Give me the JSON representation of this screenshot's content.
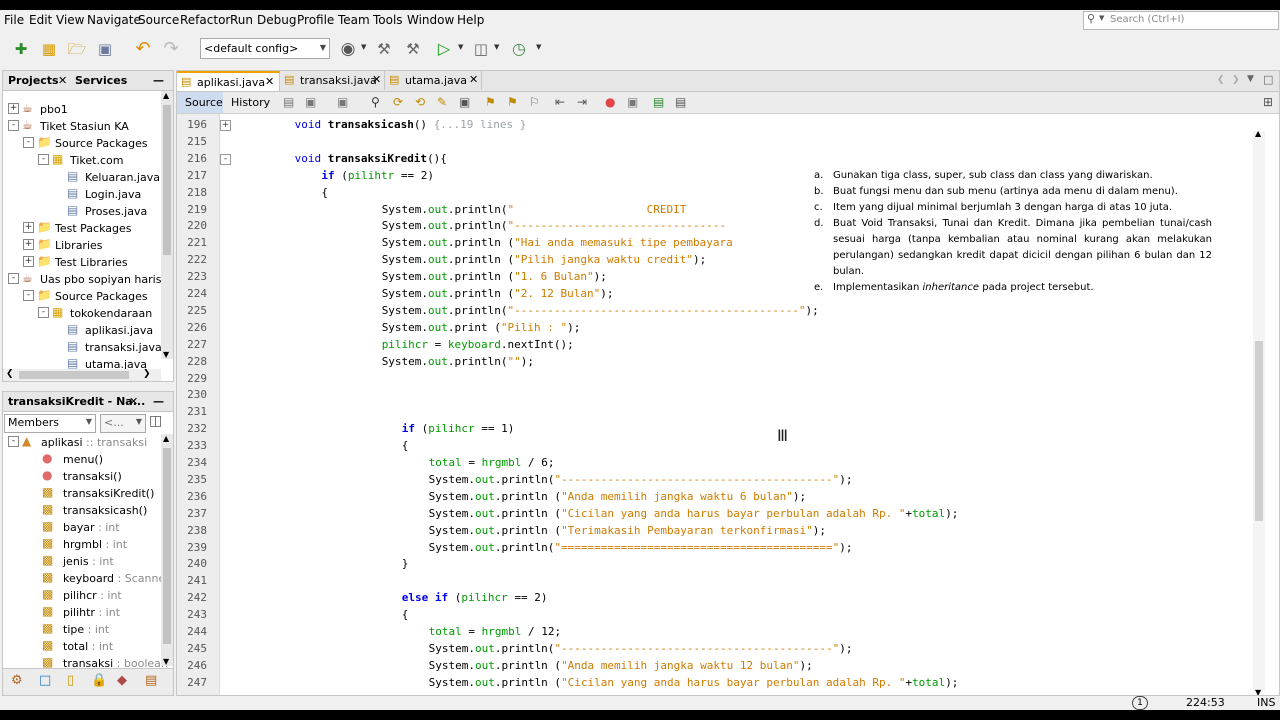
{
  "menu": [
    "File",
    "Edit",
    "View",
    "Navigate",
    "Source",
    "Refactor",
    "Run",
    "Debug",
    "Profile",
    "Team",
    "Tools",
    "Window",
    "Help"
  ],
  "search": {
    "placeholder": "Search (Ctrl+I)"
  },
  "toolbar": {
    "config": "<default config>"
  },
  "projects": {
    "tab_projects": "Projects",
    "tab_services": "Services",
    "tree": [
      {
        "label": "pbo1",
        "icon": "coffee-cup",
        "depth": 0,
        "toggle": "+"
      },
      {
        "label": "Tiket Stasiun KA",
        "icon": "coffee-cup",
        "depth": 0,
        "toggle": "-"
      },
      {
        "label": "Source Packages",
        "icon": "folder",
        "depth": 1,
        "toggle": "-"
      },
      {
        "label": "Tiket.com",
        "icon": "package",
        "depth": 2,
        "toggle": "-"
      },
      {
        "label": "Keluaran.java",
        "icon": "java-file",
        "depth": 3,
        "toggle": ""
      },
      {
        "label": "Login.java",
        "icon": "java-file",
        "depth": 3,
        "toggle": ""
      },
      {
        "label": "Proses.java",
        "icon": "java-file",
        "depth": 3,
        "toggle": ""
      },
      {
        "label": "Test Packages",
        "icon": "folder",
        "depth": 1,
        "toggle": "+"
      },
      {
        "label": "Libraries",
        "icon": "folder",
        "depth": 1,
        "toggle": "+"
      },
      {
        "label": "Test Libraries",
        "icon": "folder",
        "depth": 1,
        "toggle": "+"
      },
      {
        "label": "Uas pbo sopiyan haris n",
        "icon": "coffee-cup",
        "depth": 0,
        "toggle": "-"
      },
      {
        "label": "Source Packages",
        "icon": "folder",
        "depth": 1,
        "toggle": "-"
      },
      {
        "label": "tokokendaraan",
        "icon": "package",
        "depth": 2,
        "toggle": "-"
      },
      {
        "label": "aplikasi.java",
        "icon": "java-file",
        "depth": 3,
        "toggle": ""
      },
      {
        "label": "transaksi.java",
        "icon": "java-file",
        "depth": 3,
        "toggle": ""
      },
      {
        "label": "utama.java",
        "icon": "java-file",
        "depth": 3,
        "toggle": ""
      }
    ]
  },
  "navigator": {
    "title": "transaksiKredit - Na...",
    "members_label": "Members",
    "filter_label": "<...",
    "items": [
      {
        "label": "aplikasi",
        "type": " :: transaksi",
        "icon": "class",
        "depth": 0
      },
      {
        "label": "menu()",
        "type": "",
        "icon": "method",
        "depth": 1
      },
      {
        "label": "transaksi()",
        "type": "",
        "icon": "method",
        "depth": 1
      },
      {
        "label": "transaksiKredit()",
        "type": "",
        "icon": "method-inherited",
        "depth": 1
      },
      {
        "label": "transaksicash()",
        "type": "",
        "icon": "method-inherited",
        "depth": 1
      },
      {
        "label": "bayar",
        "type": " : int",
        "icon": "field",
        "depth": 1
      },
      {
        "label": "hrgmbl",
        "type": " : int",
        "icon": "field",
        "depth": 1
      },
      {
        "label": "jenis",
        "type": " : int",
        "icon": "field",
        "depth": 1
      },
      {
        "label": "keyboard",
        "type": " : Scanner",
        "icon": "field",
        "depth": 1
      },
      {
        "label": "pilihcr",
        "type": " : int",
        "icon": "field",
        "depth": 1
      },
      {
        "label": "pilihtr",
        "type": " : int",
        "icon": "field",
        "depth": 1
      },
      {
        "label": "tipe",
        "type": " : int",
        "icon": "field",
        "depth": 1
      },
      {
        "label": "total",
        "type": " : int",
        "icon": "field",
        "depth": 1
      },
      {
        "label": "transaksi",
        "type": " : boolean",
        "icon": "field",
        "depth": 1
      }
    ]
  },
  "editor": {
    "tabs": [
      {
        "label": "aplikasi.java",
        "active": true
      },
      {
        "label": "transaksi.java",
        "active": false
      },
      {
        "label": "utama.java",
        "active": false
      }
    ],
    "source_tab": "Source",
    "history_tab": "History",
    "lines": [
      {
        "n": "196",
        "fold": "+",
        "indent": 8,
        "seg": [
          [
            "kw",
            "void "
          ],
          [
            "fn",
            "transaksicash"
          ],
          [
            "",
            "() "
          ],
          [
            "fl",
            "{...19 lines }"
          ]
        ]
      },
      {
        "n": "215",
        "fold": "",
        "indent": 0,
        "seg": []
      },
      {
        "n": "216",
        "fold": "-",
        "indent": 8,
        "seg": [
          [
            "kw",
            "void "
          ],
          [
            "fn",
            "transaksiKredit"
          ],
          [
            "",
            "(){"
          ]
        ]
      },
      {
        "n": "217",
        "fold": "",
        "indent": 12,
        "seg": [
          [
            "kwb",
            "if"
          ],
          [
            "",
            " ("
          ],
          [
            "fld",
            "pilihtr"
          ],
          [
            "",
            " == 2)"
          ]
        ]
      },
      {
        "n": "218",
        "fold": "",
        "indent": 12,
        "seg": [
          [
            "",
            "{"
          ]
        ]
      },
      {
        "n": "219",
        "fold": "",
        "indent": 21,
        "seg": [
          [
            "",
            "System."
          ],
          [
            "fld",
            "out"
          ],
          [
            "",
            ".println("
          ],
          [
            "st",
            "\"                    CREDIT"
          ]
        ]
      },
      {
        "n": "220",
        "fold": "",
        "indent": 21,
        "seg": [
          [
            "",
            "System."
          ],
          [
            "fld",
            "out"
          ],
          [
            "",
            ".println("
          ],
          [
            "st",
            "\"--------------------------------"
          ]
        ]
      },
      {
        "n": "221",
        "fold": "",
        "indent": 21,
        "seg": [
          [
            "",
            "System."
          ],
          [
            "fld",
            "out"
          ],
          [
            "",
            ".println ("
          ],
          [
            "st",
            "\"Hai anda memasuki tipe pembayara"
          ]
        ]
      },
      {
        "n": "222",
        "fold": "",
        "indent": 21,
        "seg": [
          [
            "",
            "System."
          ],
          [
            "fld",
            "out"
          ],
          [
            "",
            ".println ("
          ],
          [
            "st",
            "\"Pilih jangka waktu credit\""
          ],
          [
            "",
            ");"
          ]
        ]
      },
      {
        "n": "223",
        "fold": "",
        "indent": 21,
        "seg": [
          [
            "",
            "System."
          ],
          [
            "fld",
            "out"
          ],
          [
            "",
            ".println ("
          ],
          [
            "st",
            "\"1. 6 Bulan\""
          ],
          [
            "",
            ");"
          ]
        ]
      },
      {
        "n": "224",
        "fold": "",
        "indent": 21,
        "seg": [
          [
            "",
            "System."
          ],
          [
            "fld",
            "out"
          ],
          [
            "",
            ".println ("
          ],
          [
            "st",
            "\"2. 12 Bulan\""
          ],
          [
            "",
            ");"
          ]
        ]
      },
      {
        "n": "225",
        "fold": "",
        "indent": 21,
        "seg": [
          [
            "",
            "System."
          ],
          [
            "fld",
            "out"
          ],
          [
            "",
            ".println("
          ],
          [
            "st",
            "\"-------------------------------------------\""
          ],
          [
            "",
            ");"
          ]
        ]
      },
      {
        "n": "226",
        "fold": "",
        "indent": 21,
        "seg": [
          [
            "",
            "System."
          ],
          [
            "fld",
            "out"
          ],
          [
            "",
            ".print ("
          ],
          [
            "st",
            "\"Pilih : \""
          ],
          [
            "",
            ");"
          ]
        ]
      },
      {
        "n": "227",
        "fold": "",
        "indent": 21,
        "seg": [
          [
            "fld",
            "pilihcr"
          ],
          [
            "",
            " = "
          ],
          [
            "fld",
            "keyboard"
          ],
          [
            "",
            ".nextInt();"
          ]
        ]
      },
      {
        "n": "228",
        "fold": "",
        "indent": 21,
        "seg": [
          [
            "",
            "System."
          ],
          [
            "fld",
            "out"
          ],
          [
            "",
            ".println("
          ],
          [
            "st",
            "\"\""
          ],
          [
            "",
            ");"
          ]
        ]
      },
      {
        "n": "229",
        "fold": "",
        "indent": 0,
        "seg": []
      },
      {
        "n": "230",
        "fold": "",
        "indent": 0,
        "seg": []
      },
      {
        "n": "231",
        "fold": "",
        "indent": 0,
        "seg": []
      },
      {
        "n": "232",
        "fold": "",
        "indent": 24,
        "seg": [
          [
            "kwb",
            "if"
          ],
          [
            "",
            " ("
          ],
          [
            "fld",
            "pilihcr"
          ],
          [
            "",
            " == 1)"
          ]
        ]
      },
      {
        "n": "233",
        "fold": "",
        "indent": 24,
        "seg": [
          [
            "",
            "{"
          ]
        ]
      },
      {
        "n": "234",
        "fold": "",
        "indent": 28,
        "seg": [
          [
            "fld",
            "total"
          ],
          [
            "",
            " = "
          ],
          [
            "fld",
            "hrgmbl"
          ],
          [
            "",
            " / 6;"
          ]
        ]
      },
      {
        "n": "235",
        "fold": "",
        "indent": 28,
        "seg": [
          [
            "",
            "System."
          ],
          [
            "fld",
            "out"
          ],
          [
            "",
            ".println("
          ],
          [
            "st",
            "\"-----------------------------------------\""
          ],
          [
            "",
            ");"
          ]
        ]
      },
      {
        "n": "236",
        "fold": "",
        "indent": 28,
        "seg": [
          [
            "",
            "System."
          ],
          [
            "fld",
            "out"
          ],
          [
            "",
            ".println ("
          ],
          [
            "st",
            "\"Anda memilih jangka waktu 6 bulan\""
          ],
          [
            "",
            ");"
          ]
        ]
      },
      {
        "n": "237",
        "fold": "",
        "indent": 28,
        "seg": [
          [
            "",
            "System."
          ],
          [
            "fld",
            "out"
          ],
          [
            "",
            ".println ("
          ],
          [
            "st",
            "\"Cicilan yang anda harus bayar perbulan adalah Rp. \""
          ],
          [
            "",
            "+"
          ],
          [
            "fld",
            "total"
          ],
          [
            "",
            ");"
          ]
        ]
      },
      {
        "n": "238",
        "fold": "",
        "indent": 28,
        "seg": [
          [
            "",
            "System."
          ],
          [
            "fld",
            "out"
          ],
          [
            "",
            ".println ("
          ],
          [
            "st",
            "\"Terimakasih Pembayaran terkonfirmasi\""
          ],
          [
            "",
            ");"
          ]
        ]
      },
      {
        "n": "239",
        "fold": "",
        "indent": 28,
        "seg": [
          [
            "",
            "System."
          ],
          [
            "fld",
            "out"
          ],
          [
            "",
            ".println("
          ],
          [
            "st",
            "\"=========================================\""
          ],
          [
            "",
            ");"
          ]
        ]
      },
      {
        "n": "240",
        "fold": "",
        "indent": 24,
        "seg": [
          [
            "",
            "}"
          ]
        ]
      },
      {
        "n": "241",
        "fold": "",
        "indent": 0,
        "seg": []
      },
      {
        "n": "242",
        "fold": "",
        "indent": 24,
        "seg": [
          [
            "kwb",
            "else if"
          ],
          [
            "",
            " ("
          ],
          [
            "fld",
            "pilihcr"
          ],
          [
            "",
            " == 2)"
          ]
        ]
      },
      {
        "n": "243",
        "fold": "",
        "indent": 24,
        "seg": [
          [
            "",
            "{"
          ]
        ]
      },
      {
        "n": "244",
        "fold": "",
        "indent": 28,
        "seg": [
          [
            "fld",
            "total"
          ],
          [
            "",
            " = "
          ],
          [
            "fld",
            "hrgmbl"
          ],
          [
            "",
            " / 12;"
          ]
        ]
      },
      {
        "n": "245",
        "fold": "",
        "indent": 28,
        "seg": [
          [
            "",
            "System."
          ],
          [
            "fld",
            "out"
          ],
          [
            "",
            ".println("
          ],
          [
            "st",
            "\"-----------------------------------------\""
          ],
          [
            "",
            ");"
          ]
        ]
      },
      {
        "n": "246",
        "fold": "",
        "indent": 28,
        "seg": [
          [
            "",
            "System."
          ],
          [
            "fld",
            "out"
          ],
          [
            "",
            ".println ("
          ],
          [
            "st",
            "\"Anda memilih jangka waktu 12 bulan\""
          ],
          [
            "",
            ");"
          ]
        ]
      },
      {
        "n": "247",
        "fold": "",
        "indent": 28,
        "seg": [
          [
            "",
            "System."
          ],
          [
            "fld",
            "out"
          ],
          [
            "",
            ".println ("
          ],
          [
            "st",
            "\"Cicilan yang anda harus bayar perbulan adalah Rp. \""
          ],
          [
            "",
            "+"
          ],
          [
            "fld",
            "total"
          ],
          [
            "",
            ");"
          ]
        ]
      }
    ]
  },
  "overlay": {
    "items": [
      {
        "letter": "a.",
        "text": "Gunakan tiga class, super, sub class dan class yang diwariskan."
      },
      {
        "letter": "b.",
        "text": "Buat fungsi menu dan sub menu (artinya ada menu di dalam menu)."
      },
      {
        "letter": "c.",
        "text": "Item yang dijual minimal berjumlah 3 dengan harga di atas 10 juta."
      },
      {
        "letter": "d.",
        "text": "Buat Void Transaksi, Tunai dan Kredit. Dimana jika pembelian tunai/cash sesuai harga (tanpa kembalian atau nominal kurang akan melakukan perulangan) sedangkan kredit dapat dicicil dengan pilihan 6 bulan dan 12 bulan."
      }
    ],
    "item_e": {
      "letter": "e.",
      "before": "Implementasikan ",
      "emph": "inheritance",
      "after": " pada project tersebut."
    }
  },
  "status": {
    "notifications": "1",
    "position": "224:53",
    "mode": "INS"
  }
}
